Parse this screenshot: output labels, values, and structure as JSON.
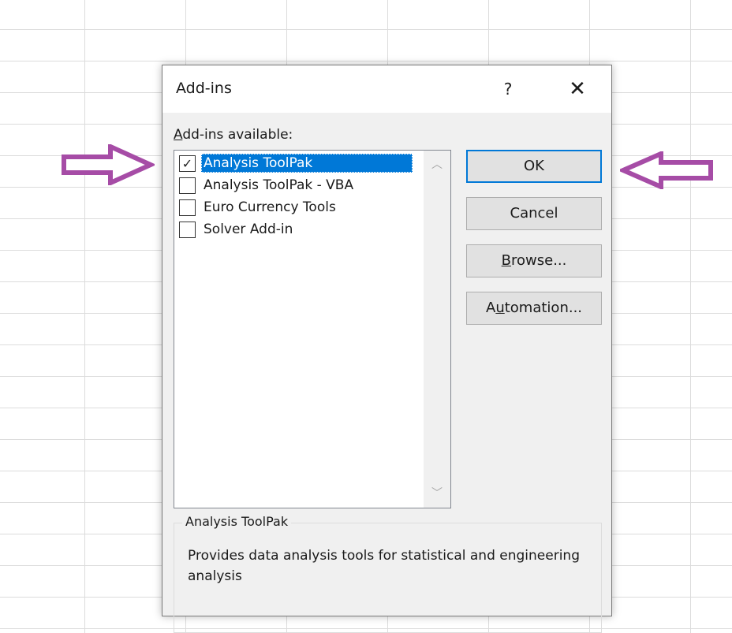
{
  "dialog": {
    "title": "Add-ins",
    "help_label": "?",
    "close_label": "✕",
    "available_label": {
      "mnemonic": "A",
      "rest": "dd-ins available:"
    }
  },
  "addins": [
    {
      "label": "Analysis ToolPak",
      "checked": true,
      "selected": true,
      "check_glyph": "✓"
    },
    {
      "label": "Analysis ToolPak - VBA",
      "checked": false,
      "selected": false,
      "check_glyph": ""
    },
    {
      "label": "Euro Currency Tools",
      "checked": false,
      "selected": false,
      "check_glyph": ""
    },
    {
      "label": "Solver Add-in",
      "checked": false,
      "selected": false,
      "check_glyph": ""
    }
  ],
  "scrollbar": {
    "up_glyph": "︿",
    "down_glyph": "﹀"
  },
  "buttons": {
    "ok": {
      "label": "OK"
    },
    "cancel": {
      "label": "Cancel"
    },
    "browse": {
      "mnemonic": "B",
      "rest": "rowse..."
    },
    "automation": {
      "pre": "A",
      "mnemonic": "u",
      "rest": "tomation..."
    }
  },
  "description": {
    "group_title": "Analysis ToolPak",
    "text": "Provides data analysis tools for statistical and engineering analysis"
  },
  "annotations": {
    "arrow_color": "#a64ca6"
  }
}
